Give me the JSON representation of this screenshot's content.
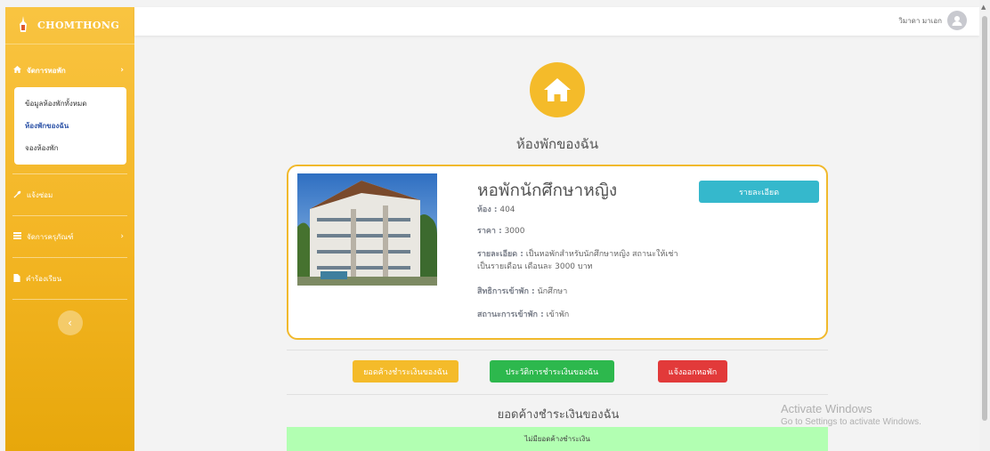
{
  "sidebar": {
    "brand": "CHOMTHONG",
    "menu_manage": "จัดการหอพัก",
    "sub_all": "ข้อมูลห้องพักทั้งหมด",
    "sub_mine": "ห้องพักของฉัน",
    "sub_book": "จองห้องพัก",
    "menu_repair": "แจ้งซ่อม",
    "menu_equipment": "จัดการครุภัณฑ์",
    "menu_complaint": "คำร้องเรียน"
  },
  "topbar": {
    "user_name": "วิมาดา มาเอก"
  },
  "main": {
    "page_title": "ห้องพักของฉัน",
    "dorm_name": "หอพักนักศึกษาหญิง",
    "detail_button": "รายละเอียด",
    "room_label": "ห้อง :",
    "room_value": "404",
    "price_label": "ราคา :",
    "price_value": "3000",
    "desc_label": "รายละเอียด :",
    "desc_value": "เป็นหอพักสำหรับนักศึกษาหญิง สถานะให้เช่าเป็นรายเดือน เดือนละ 3000 บาท",
    "right_label": "สิทธิการเข้าพัก :",
    "right_value": "นักศึกษา",
    "status_label": "สถานะการเข้าพัก :",
    "status_value": "เข้าพัก",
    "btn_owe": "ยอดค้างชำระเงินของฉัน",
    "btn_history": "ประวัติการชำระเงินของฉัน",
    "btn_checkout": "แจ้งออกหอพัก",
    "section_title": "ยอดค้างชำระเงินของฉัน",
    "no_debt": "ไม่มียอดค้างชำระเงิน"
  },
  "watermark": {
    "line1": "Activate Windows",
    "line2": "Go to Settings to activate Windows."
  },
  "colors": {
    "accent": "#f4bb2a",
    "info": "#35b8cc",
    "success": "#2db84d",
    "danger": "#e23a3a"
  }
}
